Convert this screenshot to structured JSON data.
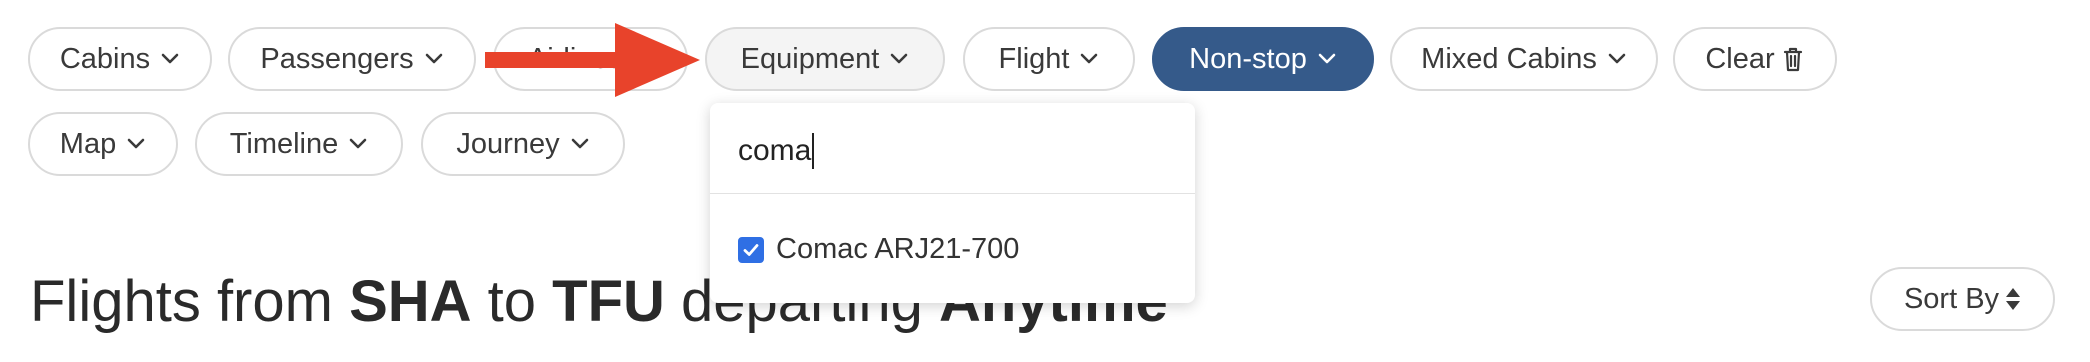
{
  "filters_row1": [
    {
      "label": "Cabins"
    },
    {
      "label": "Passengers"
    },
    {
      "label": "Airlines"
    },
    {
      "label": "Equipment"
    },
    {
      "label": "Flight"
    },
    {
      "label": "Non-stop"
    },
    {
      "label": "Mixed Cabins"
    },
    {
      "label": "Clear"
    }
  ],
  "filters_row2": [
    {
      "label": "Map"
    },
    {
      "label": "Timeline"
    },
    {
      "label": "Journey"
    }
  ],
  "equipment_dropdown": {
    "search_value": "coma",
    "options": [
      {
        "label": "Comac ARJ21-700",
        "checked": true
      }
    ]
  },
  "heading": {
    "prefix": "Flights from ",
    "origin": "SHA",
    "to": " to ",
    "destination": "TFU",
    "departing": " departing ",
    "time": "Anytime"
  },
  "sort": {
    "label": "Sort By"
  },
  "colors": {
    "active_pill": "#355a8a",
    "annotation_arrow": "#e8432b",
    "checkbox": "#2f6fe4"
  },
  "icons": {
    "chevron": "chevron-down-icon",
    "clear": "trash-icon",
    "sort": "sort-icon",
    "annotation": "arrow-annotation-icon"
  }
}
